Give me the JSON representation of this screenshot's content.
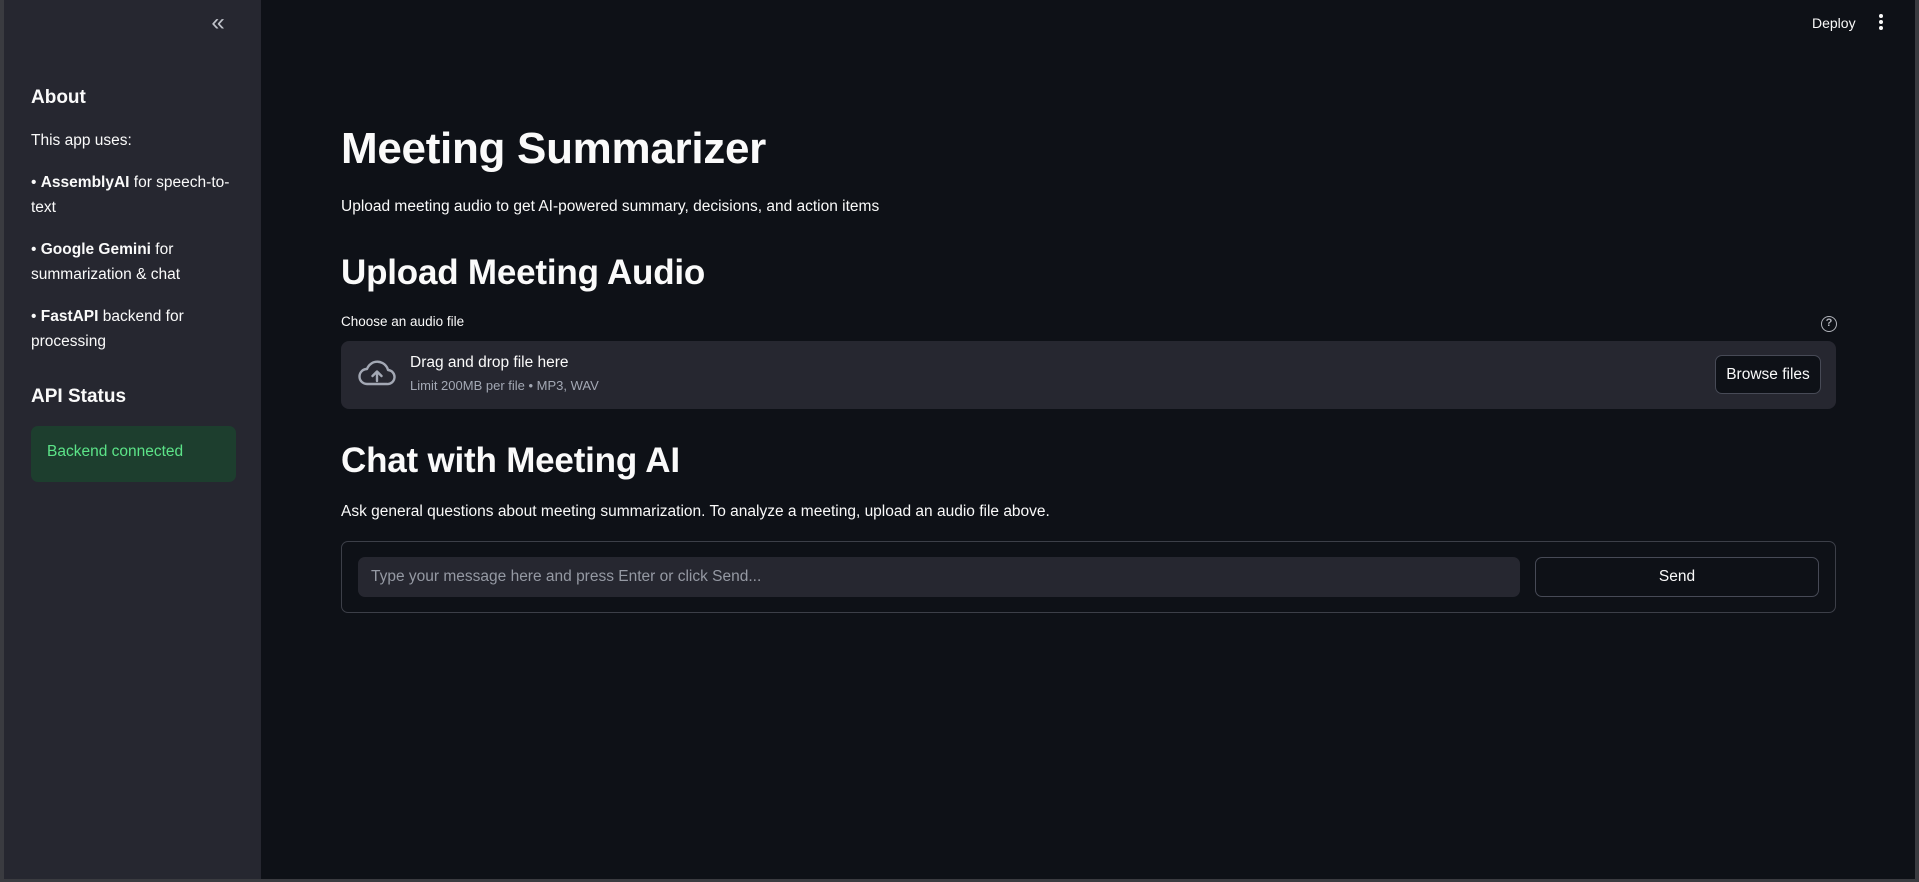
{
  "sidebar": {
    "collapse_glyph": "«",
    "about_title": "About",
    "about_intro": "This app uses:",
    "items": [
      {
        "bullet": "• ",
        "name": "AssemblyAI",
        "desc": " for speech-to-text"
      },
      {
        "bullet": "• ",
        "name": "Google Gemini",
        "desc": " for summarization & chat"
      },
      {
        "bullet": "• ",
        "name": "FastAPI",
        "desc": " backend for processing"
      }
    ],
    "api_title": "API Status",
    "api_status": "Backend connected"
  },
  "header": {
    "deploy_label": "Deploy"
  },
  "main": {
    "title": "Meeting Summarizer",
    "subtitle": "Upload meeting audio to get AI-powered summary, decisions, and action items",
    "upload_heading": "Upload Meeting Audio",
    "file_label": "Choose an audio file",
    "help_glyph": "?",
    "dropzone_main": "Drag and drop file here",
    "dropzone_sub": "Limit 200MB per file • MP3, WAV",
    "browse_label": "Browse files",
    "chat_heading": "Chat with Meeting AI",
    "chat_desc": "Ask general questions about meeting summarization. To analyze a meeting, upload an audio file above.",
    "chat_placeholder": "Type your message here and press Enter or click Send...",
    "chat_value": "",
    "send_label": "Send"
  },
  "colors": {
    "background": "#0e1117",
    "sidebar": "#262730",
    "success_bg": "#1d3e2e",
    "success_text": "#5ce488"
  }
}
